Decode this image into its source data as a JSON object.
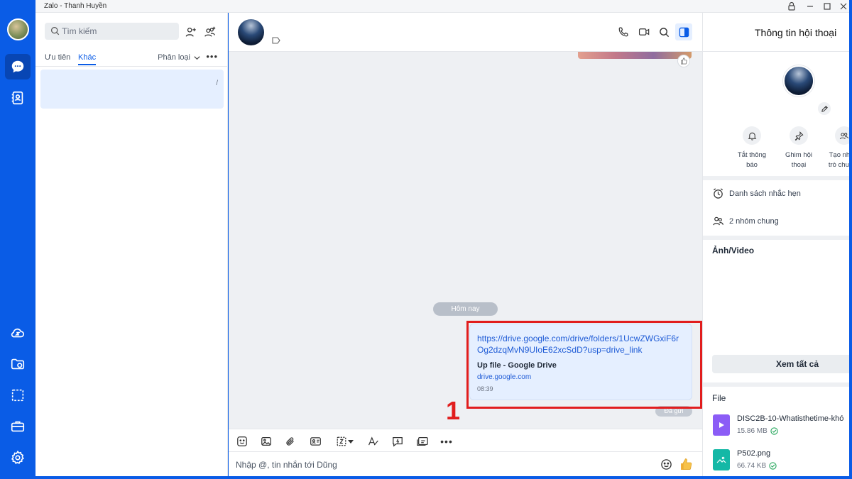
{
  "window": {
    "title": "Zalo - Thanh Huyền"
  },
  "colors": {
    "brand": "#0a5ce6",
    "highlight": "#e11d1d",
    "bubble": "#e5efff"
  },
  "sidebar": {
    "items": [
      {
        "icon": "chat-icon",
        "active": true
      },
      {
        "icon": "contacts-icon"
      },
      {
        "icon": "cloud-icon"
      },
      {
        "icon": "folder-sync-icon"
      },
      {
        "icon": "screenshot-icon"
      },
      {
        "icon": "briefcase-icon"
      },
      {
        "icon": "gear-icon"
      }
    ]
  },
  "convlist": {
    "search_placeholder": "Tìm kiếm",
    "tabs": [
      {
        "label": "Ưu tiên"
      },
      {
        "label": "Khác",
        "active": true
      }
    ],
    "filter_label": "Phân loại",
    "more_label": "•••",
    "item_mark": "/"
  },
  "chat": {
    "date_divider": "Hôm nay",
    "message": {
      "link": "https://drive.google.com/drive/folders/1UcwZWGxiF6rOg2dzqMvN9UIoE62xcSdD?usp=drive_link",
      "preview_title": "Up file - Google Drive",
      "preview_domain": "drive.google.com",
      "time": "08:39"
    },
    "sent_status": "Đã gửi",
    "annotation_number": "1",
    "composer_placeholder": "Nhập @, tin nhắn tới Dũng"
  },
  "info_panel": {
    "title": "Thông tin hội thoại",
    "quick_actions": [
      {
        "label": "Tắt thông\nbáo",
        "icon": "bell-icon"
      },
      {
        "label": "Ghim hội\nthoại",
        "icon": "pin-icon"
      },
      {
        "label": "Tạo nhóm\ntrò chuyện",
        "icon": "group-add-icon"
      }
    ],
    "reminders_label": "Danh sách nhắc hẹn",
    "groups_label": "2 nhóm chung",
    "media_title": "Ảnh/Video",
    "view_all_label": "Xem tất cả",
    "file_title": "File",
    "files": [
      {
        "name": "DISC2B-10-Whatisthetime-khó",
        "size": "15.86 MB",
        "color": "#8b5cf6"
      },
      {
        "name": "P502.png",
        "size": "66.74 KB",
        "color": "#14b8a6"
      }
    ]
  }
}
